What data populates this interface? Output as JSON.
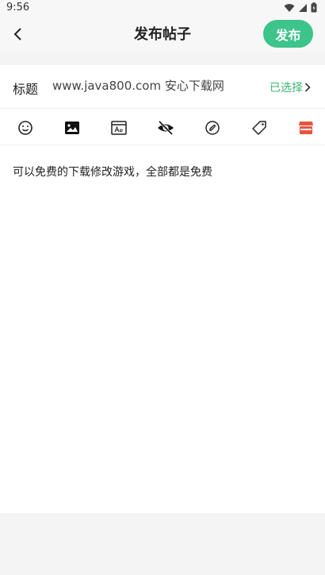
{
  "status": {
    "time": "9:56"
  },
  "header": {
    "title": "发布帖子",
    "publish_label": "发布"
  },
  "post": {
    "title_label": "标题",
    "title_value": "www.java800.com 安心下载网",
    "select_label": "已选择",
    "content": "可以免费的下载修改游戏，全部都是免费"
  },
  "toolbar": {
    "icons": [
      "emoji-icon",
      "image-icon",
      "font-icon",
      "hide-icon",
      "link-icon",
      "tag-icon",
      "store-icon"
    ],
    "accent_color": "#3cc48b",
    "store_icon_color": "#e8533f"
  }
}
